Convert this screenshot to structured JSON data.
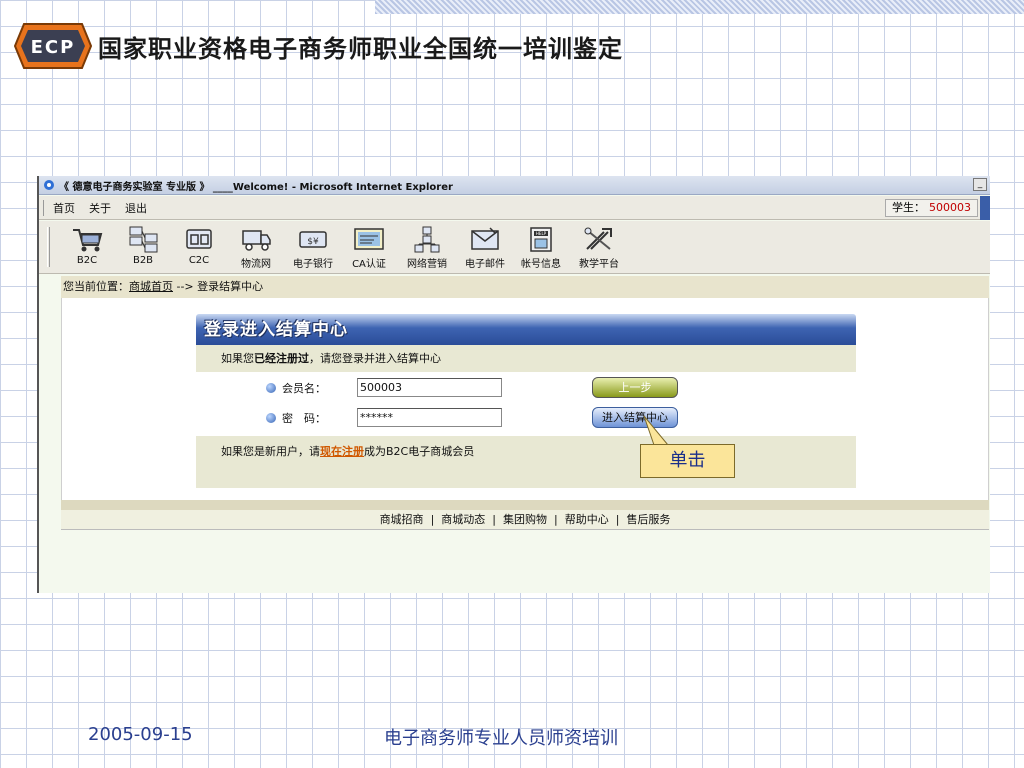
{
  "slide": {
    "title": "国家职业资格电子商务师职业全国统一培训鉴定",
    "logo_text": "ECP",
    "date": "2005-09-15",
    "caption": "电子商务师专业人员师资培训",
    "callout": "单击"
  },
  "browser": {
    "window_title": "《 德意电子商务实验室 专业版 》 ____Welcome! - Microsoft Internet Explorer",
    "menu": [
      "首页",
      "关于",
      "退出"
    ],
    "student_label": "学生：",
    "student_value": "500003",
    "toolbar": [
      {
        "label": "B2C",
        "icon": "cart-icon"
      },
      {
        "label": "B2B",
        "icon": "network-icon"
      },
      {
        "label": "C2C",
        "icon": "c2c-icon"
      },
      {
        "label": "物流网",
        "icon": "truck-icon"
      },
      {
        "label": "电子银行",
        "icon": "money-icon"
      },
      {
        "label": "CA认证",
        "icon": "certificate-icon"
      },
      {
        "label": "网络营销",
        "icon": "org-chart-icon"
      },
      {
        "label": "电子邮件",
        "icon": "mail-icon"
      },
      {
        "label": "帐号信息",
        "icon": "account-icon"
      },
      {
        "label": "教学平台",
        "icon": "tools-icon"
      }
    ],
    "breadcrumb": {
      "prefix": "您当前位置：",
      "link": "商城首页",
      "arrow": " --> ",
      "current": "登录结算中心"
    }
  },
  "login": {
    "heading": "登录进入结算中心",
    "intro_pre": "如果您",
    "intro_bold": "已经注册过",
    "intro_post": "，请您登录并进入结算中心",
    "member_label": "会员名：",
    "member_value": "500003",
    "password_label": "密　码：",
    "password_value": "******",
    "prev_button": "上一步",
    "enter_button": "进入结算中心",
    "new_user_pre": "如果您是新用户，请",
    "register_link": "现在注册",
    "new_user_post": "成为B2C电子商城会员"
  },
  "footer": {
    "links": [
      "商城招商",
      "商城动态",
      "集团购物",
      "帮助中心",
      "售后服务"
    ]
  },
  "colors": {
    "accent_blue": "#2a4c98",
    "slide_text": "#2a3f8f",
    "callout_bg": "#fbe59a",
    "student_value": "#c00000"
  }
}
